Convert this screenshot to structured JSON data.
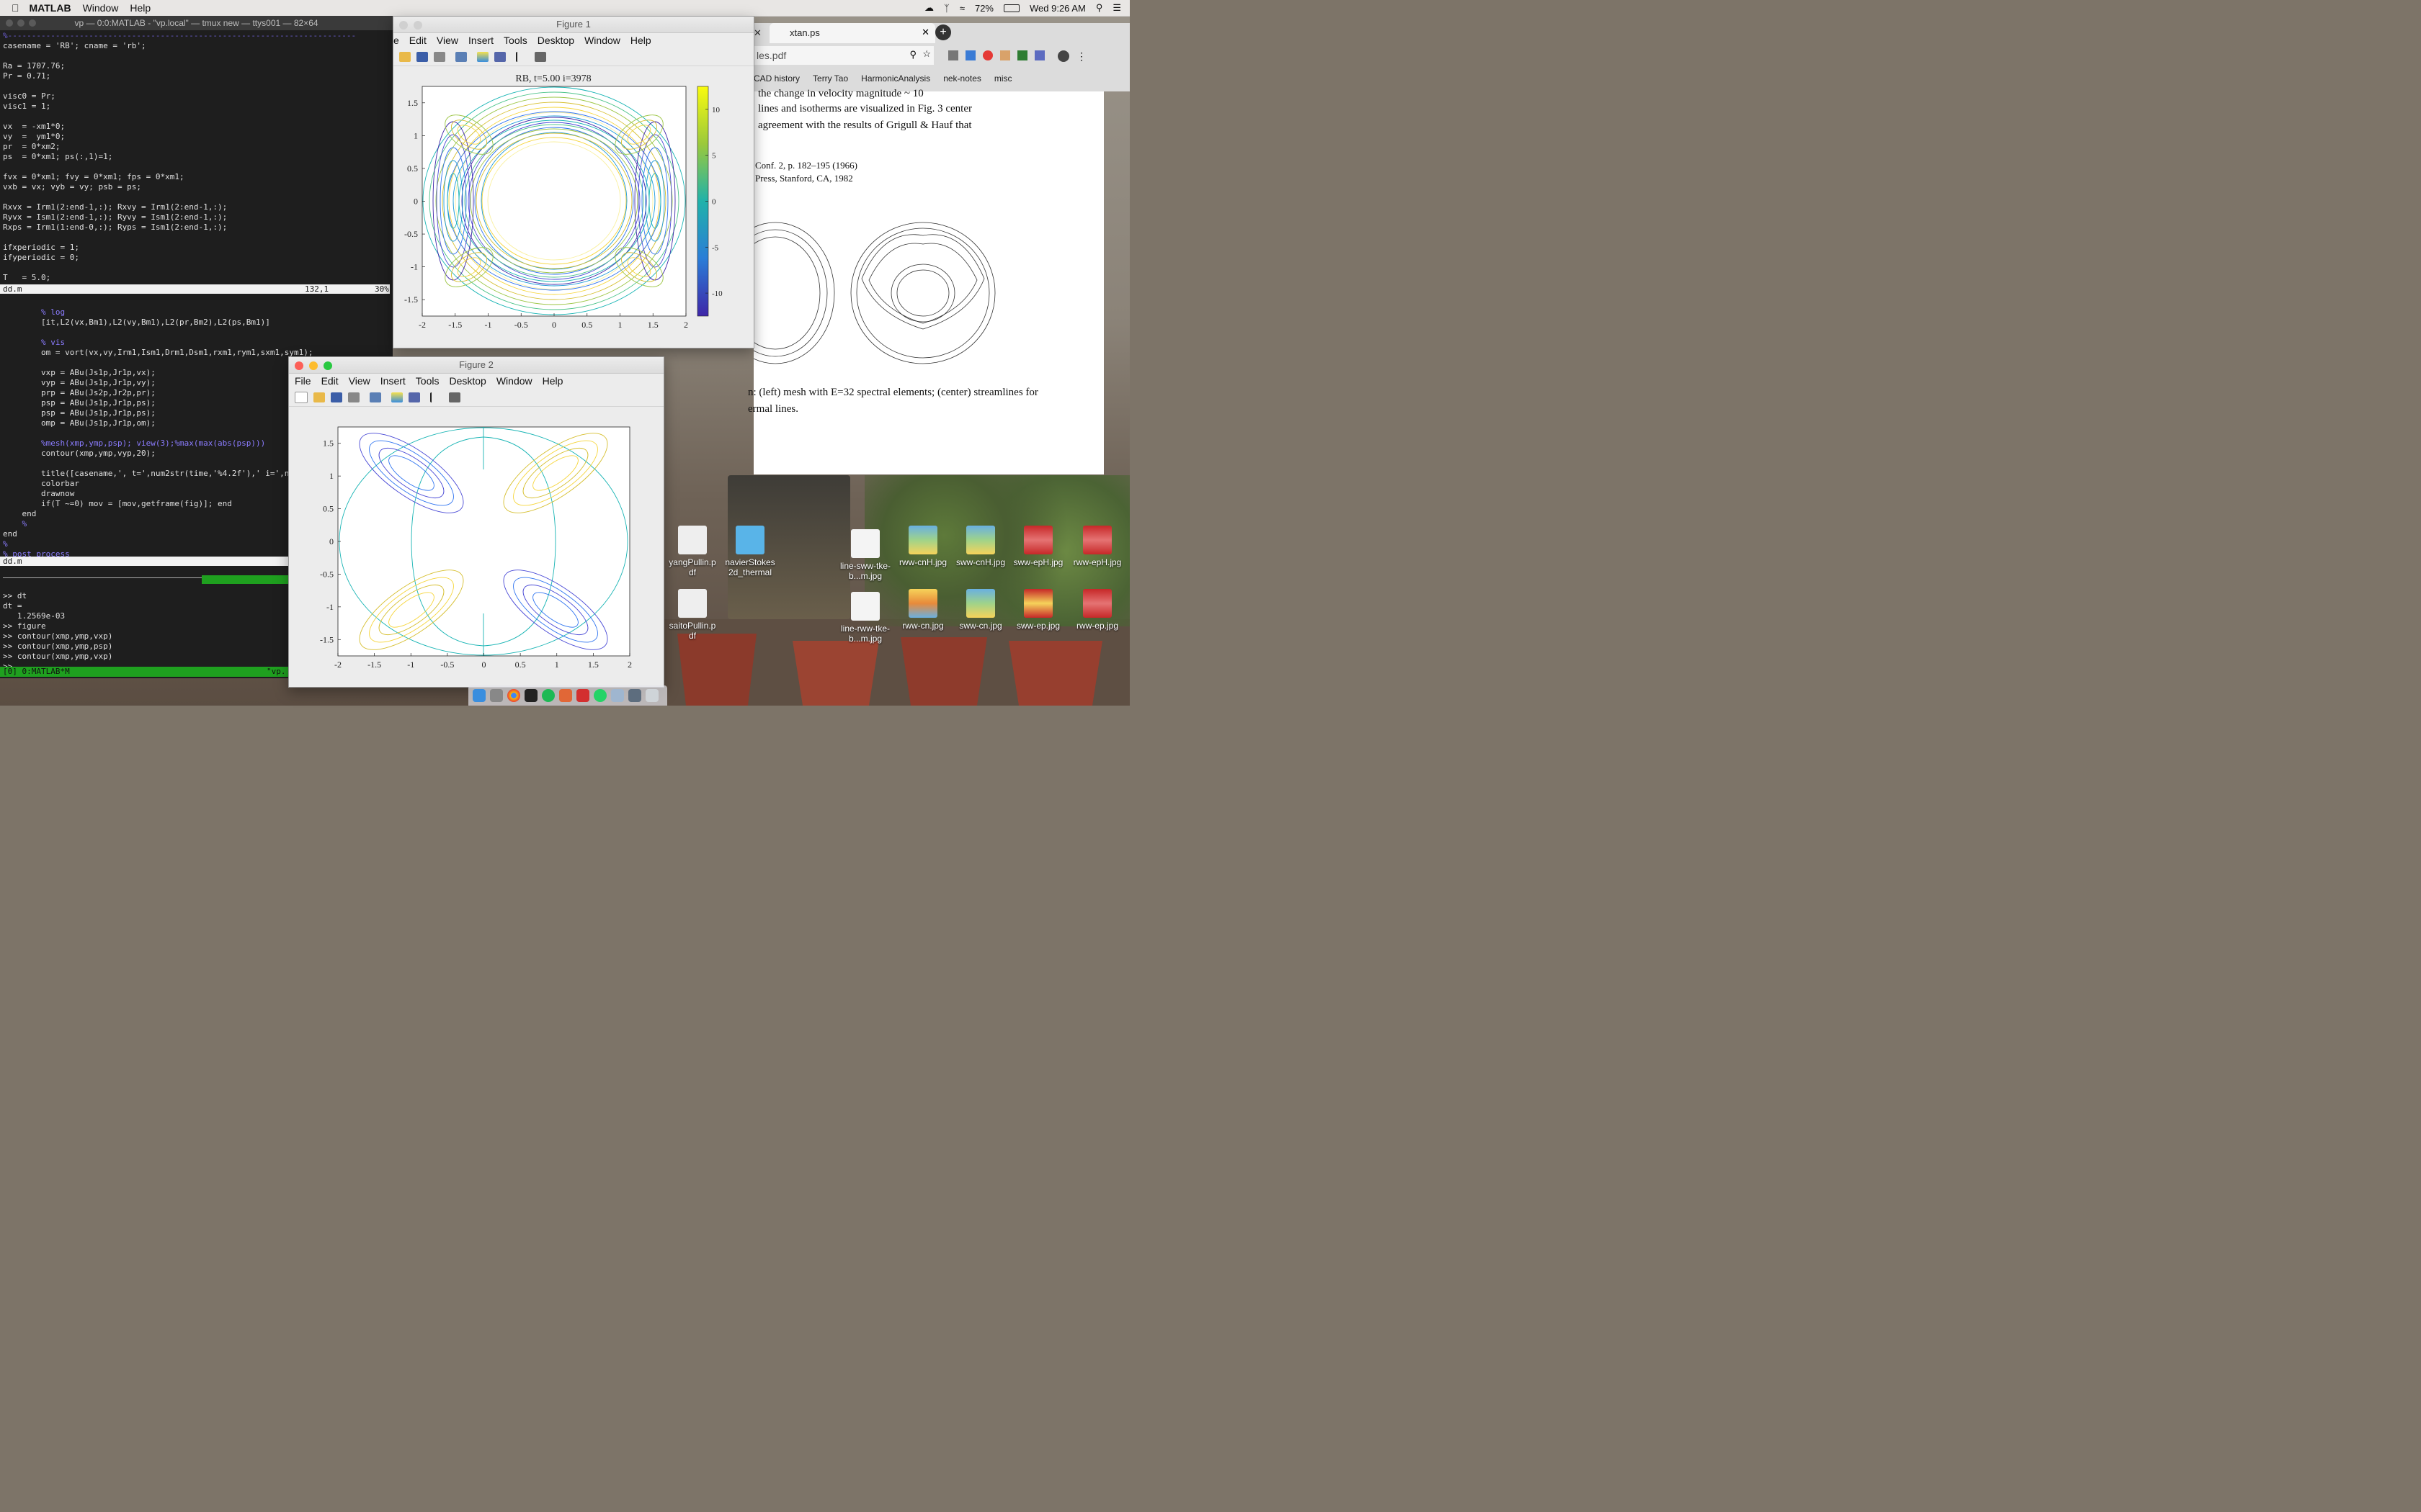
{
  "menubar": {
    "app": "MATLAB",
    "items": [
      "Window",
      "Help"
    ],
    "battery": "72%",
    "clock": "Wed 9:26 AM"
  },
  "terminal": {
    "title": "vp — 0:0:MATLAB - \"vp.local\" — tmux new — ttys001 — 82×64",
    "lines_top": [
      "casename = 'RB'; cname = 'rb';",
      "",
      "Ra = 1707.76;",
      "Pr = 0.71;",
      "",
      "visc0 = Pr;",
      "visc1 = 1;",
      "",
      "vx  = -xm1*0;",
      "vy  =  ym1*0;",
      "pr  = 0*xm2;",
      "ps  = 0*xm1; ps(:,1)=1;",
      "",
      "fvx = 0*xm1; fvy = 0*xm1; fps = 0*xm1;",
      "vxb = vx; vyb = vy; psb = ps;",
      "",
      "Rxvx = Irm1(2:end-1,:); Rxvy = Irm1(2:end-1,:);",
      "Ryvx = Ism1(2:end-1,:); Ryvy = Ism1(2:end-1,:);",
      "Rxps = Irm1(1:end-0,:); Ryps = Ism1(2:end-1,:);",
      "",
      "ifxperiodic = 1;",
      "ifyperiodic = 0;",
      "",
      "T   = 5.0;"
    ],
    "status1_file": "dd.m",
    "status1_pos": "132,1",
    "status1_pct": "30%",
    "lines_mid": [
      "",
      "        % log",
      "        [it,L2(vx,Bm1),L2(vy,Bm1),L2(pr,Bm2),L2(ps,Bm1)]",
      "",
      "        % vis",
      "        om = vort(vx,vy,Irm1,Ism1,Drm1,Dsm1,rxm1,rym1,sxm1,sym1);",
      "",
      "        vxp = ABu(Js1p,Jr1p,vx);",
      "        vyp = ABu(Js1p,Jr1p,vy);",
      "        prp = ABu(Js2p,Jr2p,pr);",
      "        psp = ABu(Js1p,Jr1p,ps);",
      "        psp = ABu(Js1p,Jr1p,ps);",
      "        omp = ABu(Js1p,Jr1p,om);",
      "",
      "        %mesh(xmp,ymp,psp); view(3);%max(max(abs(psp)))",
      "        contour(xmp,ymp,vyp,20);",
      "",
      "        title([casename,', t=',num2str(time,'%4.2f'),' i=',nu",
      "        colorbar",
      "        drawnow",
      "        if(T ~=0) mov = [mov,getframe(fig)]; end",
      "    end",
      "    %",
      "end",
      "%",
      "% post process"
    ],
    "status2_file": "dd.m",
    "lines_bottom": [
      "",
      ">> dt",
      "dt =",
      "   1.2569e-03",
      ">> figure",
      ">> contour(xmp,ymp,vxp)",
      ">> contour(xmp,ymp,psp)",
      ">> contour(xmp,ymp,vxp)",
      ">> "
    ],
    "tmux_left": "[0] 0:MATLAB*M",
    "tmux_right": "\"vp."
  },
  "figure1": {
    "title": "Figure 1",
    "menu": [
      "e",
      "Edit",
      "View",
      "Insert",
      "Tools",
      "Desktop",
      "Window",
      "Help"
    ],
    "plot_title": "RB, t=5.00 i=3978",
    "xticks": [
      "-2",
      "-1.5",
      "-1",
      "-0.5",
      "0",
      "0.5",
      "1",
      "1.5",
      "2"
    ],
    "yticks": [
      "1.5",
      "1",
      "0.5",
      "0",
      "-0.5",
      "-1",
      "-1.5"
    ],
    "cbar_ticks": [
      "10",
      "5",
      "0",
      "-5",
      "-10"
    ]
  },
  "figure2": {
    "title": "Figure 2",
    "menu": [
      "File",
      "Edit",
      "View",
      "Insert",
      "Tools",
      "Desktop",
      "Window",
      "Help"
    ],
    "xticks": [
      "-2",
      "-1.5",
      "-1",
      "-0.5",
      "0",
      "0.5",
      "1",
      "1.5",
      "2"
    ],
    "yticks": [
      "1.5",
      "1",
      "0.5",
      "0",
      "-0.5",
      "-1",
      "-1.5"
    ]
  },
  "browser": {
    "tab": "xtan.ps",
    "address": "les.pdf",
    "bookmarks": [
      "CAD history",
      "Terry Tao",
      "HarmonicAnalysis",
      "nek-notes",
      "misc"
    ]
  },
  "pdf": {
    "lines": [
      "the change in velocity magnitude ~ 10",
      "lines and isotherms are visualized in Fig. 3 center",
      "agreement with the results of Grigull & Hauf that",
      "Conf. 2, p. 182–195 (1966)",
      "Press, Stanford, CA, 1982",
      "n: (left) mesh with E=32 spectral elements; (center) streamlines for",
      "ermal lines."
    ]
  },
  "desktop_icons": [
    {
      "label": "yangPullin.p df"
    },
    {
      "label": "navierStokes 2d_thermal"
    },
    {
      "label": "line-sww-tke-b...m.jpg"
    },
    {
      "label": "rww-cnH.jpg"
    },
    {
      "label": "sww-cnH.jpg"
    },
    {
      "label": "sww-epH.jpg"
    },
    {
      "label": "rww-epH.jpg"
    },
    {
      "label": "saitoPullin.p df"
    },
    {
      "label": "line-rww-tke-b...m.jpg"
    },
    {
      "label": "rww-cn.jpg"
    },
    {
      "label": "sww-cn.jpg"
    },
    {
      "label": "sww-ep.jpg"
    },
    {
      "label": "rww-ep.jpg"
    }
  ]
}
